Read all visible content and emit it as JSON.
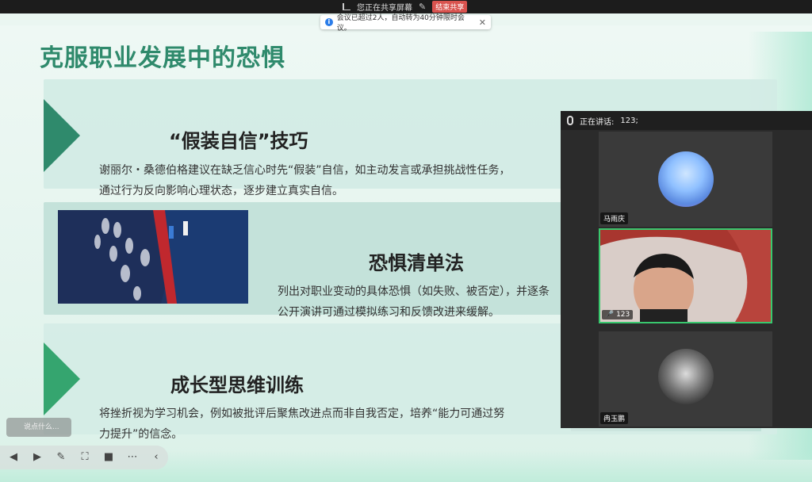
{
  "top_banner": {
    "sharing_text": "您正在共享屏幕",
    "stop_share": "结束共享"
  },
  "notice": {
    "text": "会议已超过2人，自动转为40分钟限时会议。",
    "close": "✕"
  },
  "slide": {
    "title": "克服职业发展中的恐惧",
    "sections": [
      {
        "heading": "“假装自信”技巧",
        "body": [
          "谢丽尔・桑德伯格建议在缺乏信心时先“假装”自信，如主动发言或承担挑战性任务，",
          "通过行为反向影响心理状态，逐步建立真实自信。"
        ]
      },
      {
        "heading": "恐惧清单法",
        "body": [
          "列出对职业变动的具体恐惧（如失败、被否定），并逐条",
          "公开演讲可通过模拟练习和反馈改进来缓解。"
        ]
      },
      {
        "heading": "成长型思维训练",
        "body": [
          "将挫折视为学习机会，例如被批评后聚焦改进点而非自我否定，培养“能力可通过努",
          "力提升”的信念。"
        ]
      }
    ]
  },
  "participants": {
    "speaking_label": "正在讲话:",
    "speaking_name": "123;",
    "list": [
      {
        "name": "马雨庆"
      },
      {
        "name": "123"
      },
      {
        "name": "冉玉鹏"
      }
    ]
  },
  "chat_placeholder": "说点什么...",
  "colors": {
    "accent": "#2f8a6c",
    "active_tile": "#39c86e",
    "stop_btn": "#d9534f"
  }
}
